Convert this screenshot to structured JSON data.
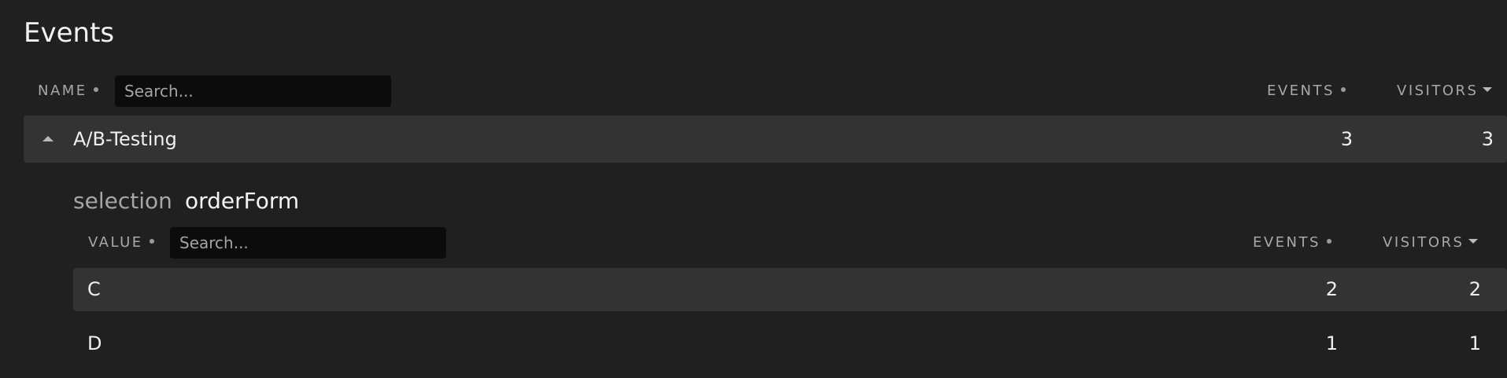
{
  "page": {
    "title": "Events"
  },
  "events_table": {
    "columns": {
      "name": "NAME",
      "events": "EVENTS",
      "visitors": "VISITORS"
    },
    "search_placeholder": "Search...",
    "rows": [
      {
        "name": "A/B-Testing",
        "events": "3",
        "visitors": "3",
        "expanded": true
      }
    ]
  },
  "property": {
    "key": "selection",
    "value": "orderForm"
  },
  "values_table": {
    "columns": {
      "value": "VALUE",
      "events": "EVENTS",
      "visitors": "VISITORS"
    },
    "search_placeholder": "Search...",
    "rows": [
      {
        "value": "C",
        "events": "2",
        "visitors": "2",
        "highlighted": true
      },
      {
        "value": "D",
        "events": "1",
        "visitors": "1",
        "highlighted": false
      }
    ]
  },
  "icons": {
    "sort_indicator": "dot-icon",
    "sort_active": "caret-down-icon",
    "collapse": "caret-up-icon"
  },
  "colors": {
    "background": "#202020",
    "row_highlight": "#333333",
    "search_bg": "#0c0c0c",
    "text_primary": "#f0f0f0",
    "text_muted": "#a8a8a8"
  }
}
